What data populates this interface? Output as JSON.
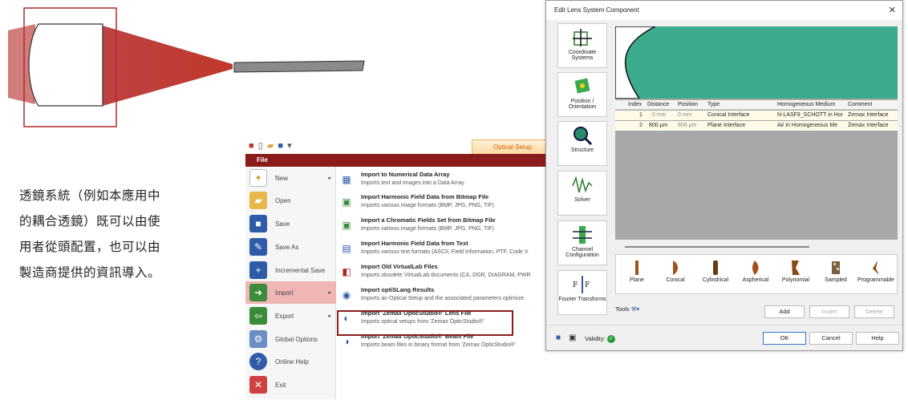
{
  "caption": {
    "lines": [
      "透鏡系統（例如本應用中",
      "的耦合透鏡）既可以由使",
      "用者從頭配置，也可以由",
      "製造商提供的資訊導入。"
    ]
  },
  "menu": {
    "optical_setup_tab": "Optical Setup",
    "file_tab": "File",
    "left_items": [
      {
        "label": "New",
        "icon": "new-document-icon",
        "arrow": true
      },
      {
        "label": "Open",
        "icon": "folder-icon",
        "arrow": false
      },
      {
        "label": "Save",
        "icon": "floppy-disk-icon",
        "arrow": false
      },
      {
        "label": "Save As",
        "icon": "save-as-icon",
        "arrow": false
      },
      {
        "label": "Incremental Save",
        "icon": "incremental-save-icon",
        "arrow": false
      },
      {
        "label": "Import",
        "icon": "import-icon",
        "arrow": true,
        "active": true
      },
      {
        "label": "Export",
        "icon": "export-icon",
        "arrow": true
      },
      {
        "label": "Global Options",
        "icon": "gears-icon",
        "arrow": false
      },
      {
        "label": "Online Help",
        "icon": "help-icon",
        "arrow": false
      },
      {
        "label": "Exit",
        "icon": "exit-icon",
        "arrow": false
      }
    ],
    "import_items": [
      {
        "title": "Import to Numerical Data Array",
        "subtitle": "Imports text and images into a Data Array"
      },
      {
        "title": "Import Harmonic Field Data from Bitmap File",
        "subtitle": "Imports various image formats (BMP, JPG, PNG, TIF)"
      },
      {
        "title": "Import a Chromatic Fields Set from Bitmap File",
        "subtitle": "Imports various image formats (BMP, JPG, PNG, TIF)"
      },
      {
        "title": "Import Harmonic Field Data from Text",
        "subtitle": "Imports various text formats (ASCII, Field Information, PTF, Code V"
      },
      {
        "title": "Import Old VirtualLab Files",
        "subtitle": "Imports obsolete VirtualLab documents (CA, DGR, DIAGRAM, PWR"
      },
      {
        "title": "Import optiSLang Results",
        "subtitle": "Imports an Optical Setup and the associated parameters optimize"
      },
      {
        "title": "Import 'Zemax OpticStudio®' Lens File",
        "subtitle": "Imports optical setups from 'Zemax OpticStudio®'"
      },
      {
        "title": "Import 'Zemax OpticStudio®' Beam File",
        "subtitle": "Imports beam files in binary format from 'Zemax OpticStudio®'"
      }
    ]
  },
  "dialog": {
    "title": "Edit Lens System Component",
    "close": "✕",
    "sidebar": [
      {
        "label": "Coordinate Systems"
      },
      {
        "label": "Position / Orientation"
      },
      {
        "label": "Structure"
      },
      {
        "label": "Solver"
      },
      {
        "label": "Channel Configuration"
      },
      {
        "label": "Fourier Transforms"
      }
    ],
    "table": {
      "headers": [
        "Index",
        "Distance",
        "Position",
        "Type",
        "Homogeneous Medium",
        "Comment"
      ],
      "rows": [
        [
          "1",
          "0 mm",
          "0 mm",
          "Conical Interface",
          "N-LASF9_SCHOTT in Hor",
          "Zemax Interface"
        ],
        [
          "2",
          "800 µm",
          "800 µm",
          "Plane Interface",
          "Air in Homogeneous Me",
          "Zemax Interface"
        ]
      ]
    },
    "shapes": [
      "Plane",
      "Conical",
      "Cylindrical",
      "Aspherical",
      "Polynomial",
      "Sampled",
      "Programmable"
    ],
    "tools_label": "Tools",
    "add": "Add",
    "insert": "Insert",
    "delete": "Delete",
    "validity": "Validity:",
    "ok": "OK",
    "cancel": "Cancel",
    "help": "Help"
  }
}
